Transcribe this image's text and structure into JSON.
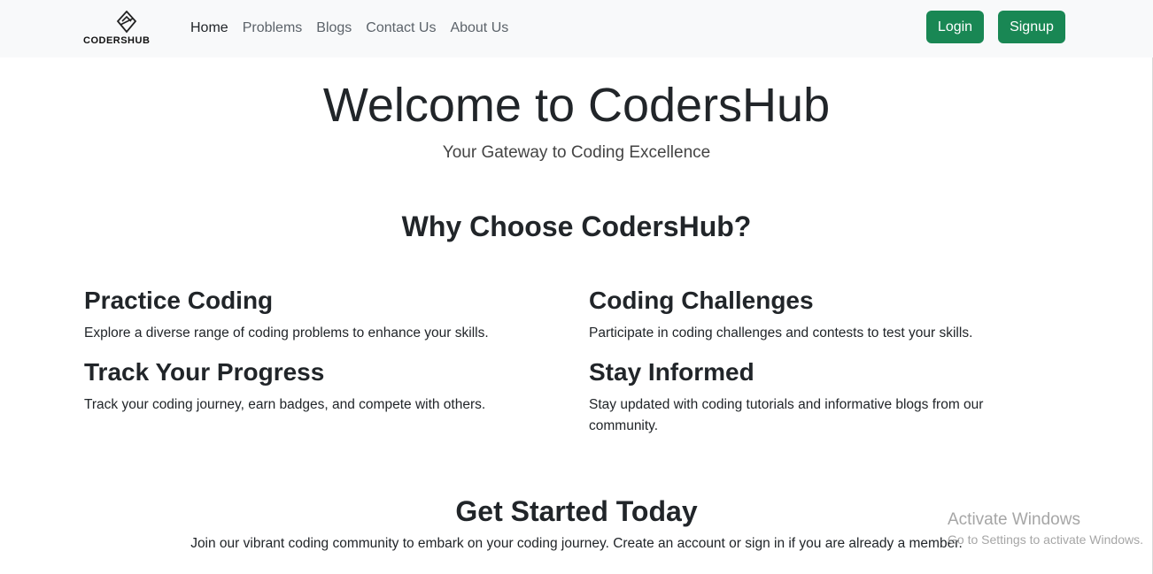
{
  "brand": {
    "name": "CODERSHUB",
    "logo_icon": "codershub-logo-icon"
  },
  "nav": {
    "links": [
      {
        "label": "Home",
        "active": true
      },
      {
        "label": "Problems",
        "active": false
      },
      {
        "label": "Blogs",
        "active": false
      },
      {
        "label": "Contact Us",
        "active": false
      },
      {
        "label": "About Us",
        "active": false
      }
    ],
    "login_label": "Login",
    "signup_label": "Signup",
    "button_color": "#198754"
  },
  "hero": {
    "title": "Welcome to CodersHub",
    "subtitle": "Your Gateway to Coding Excellence"
  },
  "why": {
    "title": "Why Choose CodersHub?",
    "features": [
      {
        "title": "Practice Coding",
        "text": "Explore a diverse range of coding problems to enhance your skills."
      },
      {
        "title": "Coding Challenges",
        "text": "Participate in coding challenges and contests to test your skills."
      },
      {
        "title": "Track Your Progress",
        "text": "Track your coding journey, earn badges, and compete with others."
      },
      {
        "title": "Stay Informed",
        "text": "Stay updated with coding tutorials and informative blogs from our community."
      }
    ]
  },
  "cta": {
    "title": "Get Started Today",
    "text": "Join our vibrant coding community to embark on your coding journey. Create an account or sign in if you are already a member."
  },
  "watermark": {
    "line1": "Activate Windows",
    "line2": "Go to Settings to activate Windows."
  }
}
